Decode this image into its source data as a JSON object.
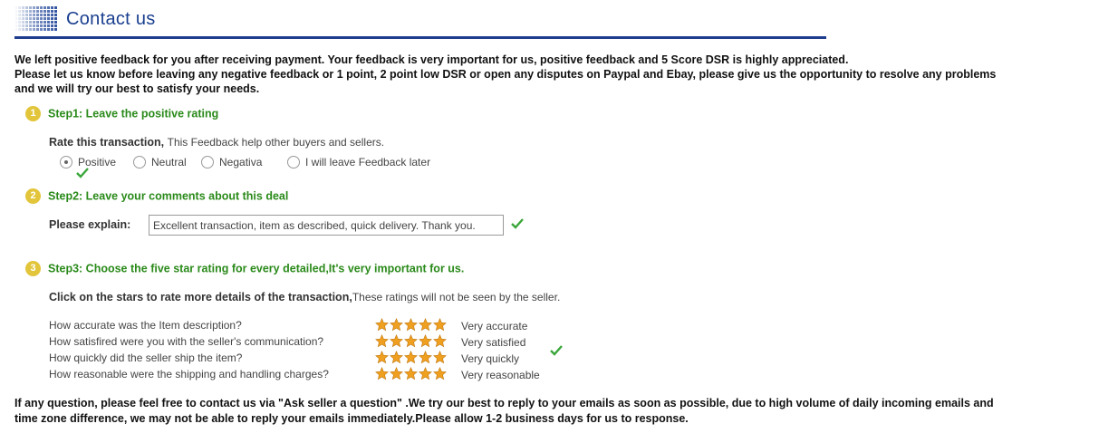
{
  "header": {
    "title": "Contact us"
  },
  "intro": {
    "line1": "We left positive feedback for you after receiving payment. Your feedback is very important for us, positive feedback and 5 Score DSR is highly appreciated.",
    "line2": "Please let us know before leaving any negative feedback or 1 point, 2 point low DSR or open any disputes on Paypal and Ebay, please give us the opportunity to resolve any problems",
    "line3": "and we will try our best to satisfy your needs."
  },
  "step1": {
    "number": "1",
    "title": "Step1: Leave the positive rating",
    "rate_label": "Rate this transaction,",
    "rate_sub": "This Feedback help other buyers and sellers.",
    "options": [
      "Positive",
      "Neutral",
      "Negativa",
      "I will leave Feedback later"
    ],
    "selected": "Positive"
  },
  "step2": {
    "number": "2",
    "title": "Step2: Leave your comments about this deal",
    "explain_label": "Please explain:",
    "explain_value": "Excellent transaction, item as described, quick delivery. Thank you."
  },
  "step3": {
    "number": "3",
    "title": "Step3: Choose the five star rating for every detailed,It's very important for us.",
    "click_label": "Click on the stars to rate more details of the transaction,",
    "click_sub": "These ratings will not be seen by the seller.",
    "ratings": [
      {
        "question": "How accurate was the Item description?",
        "stars": 5,
        "answer": "Very accurate"
      },
      {
        "question": "How satisfired were you with the seller's communication?",
        "stars": 5,
        "answer": "Very satisfied"
      },
      {
        "question": "How quickly did the seller ship the item?",
        "stars": 5,
        "answer": "Very quickly"
      },
      {
        "question": "How reasonable were the shipping and handling charges?",
        "stars": 5,
        "answer": "Very reasonable"
      }
    ]
  },
  "outro": {
    "line1": "If any question, please feel free to contact us via \"Ask seller a question\" .We try our best to reply to your emails as soon as possible, due to high volume of daily incoming emails and",
    "line2": "time zone difference, we may not be able to reply your emails immediately.Please allow 1-2 business days for us to response."
  },
  "colors": {
    "title_blue": "#1a3f8f",
    "rule_blue": "#1f3d8f",
    "step_green": "#2a8a1a",
    "badge_yellow": "#e2c53a",
    "star_orange": "#f0a020",
    "check_green": "#3aa63a"
  }
}
